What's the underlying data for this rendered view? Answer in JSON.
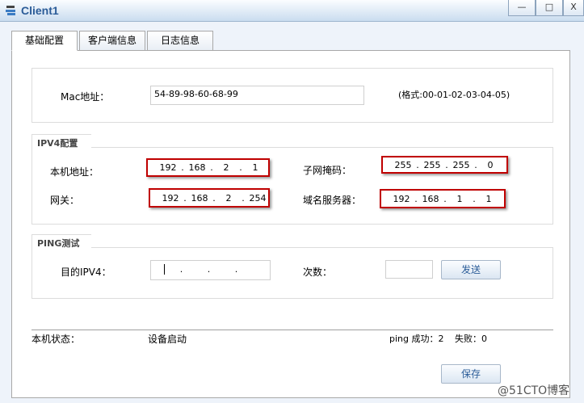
{
  "window": {
    "title": "Client1",
    "minimize": "—",
    "maximize": "□",
    "close": "X"
  },
  "tabs": [
    {
      "label": "基础配置"
    },
    {
      "label": "客户端信息"
    },
    {
      "label": "日志信息"
    }
  ],
  "mac": {
    "label": "Mac地址：",
    "value": "54-89-98-60-68-99",
    "hint": "(格式:00-01-02-03-04-05)"
  },
  "ipv4": {
    "title": "IPV4配置",
    "ip_label": "本机地址：",
    "ip": [
      "192",
      "168",
      "2",
      "1"
    ],
    "mask_label": "子网掩码：",
    "mask": [
      "255",
      "255",
      "255",
      "0"
    ],
    "gw_label": "网关：",
    "gw": [
      "192",
      "168",
      "2",
      "254"
    ],
    "dns_label": "域名服务器：",
    "dns": [
      "192",
      "168",
      "1",
      "1"
    ]
  },
  "ping": {
    "title": "PING测试",
    "dest_label": "目的IPV4：",
    "dest": [
      "",
      "",
      "",
      ""
    ],
    "count_label": "次数：",
    "count": "",
    "send": "发送"
  },
  "status": {
    "label": "本机状态：",
    "value": "设备启动",
    "ping_success_label": "ping 成功：",
    "ping_success": "2",
    "fail_label": "失败：",
    "fail": "0"
  },
  "save": "保存",
  "watermark": "@51CTO博客"
}
